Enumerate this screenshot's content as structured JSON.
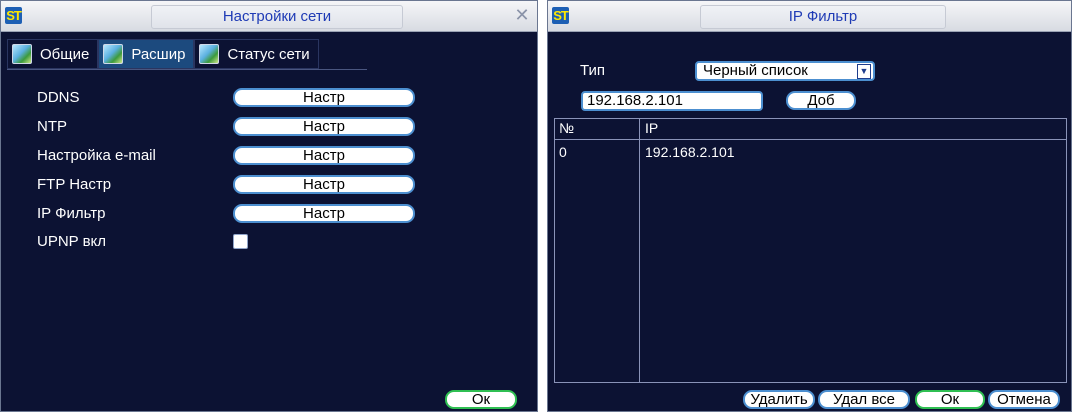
{
  "left_window": {
    "logo": "ST",
    "title": "Настройки сети",
    "tabs": [
      {
        "label": "Общие"
      },
      {
        "label": "Расшир"
      },
      {
        "label": "Статус сети"
      }
    ],
    "rows": [
      {
        "label": "DDNS",
        "button": "Настр"
      },
      {
        "label": "NTP",
        "button": "Настр"
      },
      {
        "label": "Настройка e-mail",
        "button": "Настр"
      },
      {
        "label": "FTP Настр",
        "button": "Настр"
      },
      {
        "label": "IP Фильтр",
        "button": "Настр"
      }
    ],
    "upnp": {
      "label": "UPNP вкл",
      "checked": false
    },
    "ok_label": "Ок"
  },
  "right_window": {
    "logo": "ST",
    "title": "IP Фильтр",
    "type_label": "Тип",
    "type_value": "Черный список",
    "ip_value": "192.168.2.101",
    "add_label": "Доб",
    "table": {
      "headers": [
        "№",
        "IP"
      ],
      "rows": [
        [
          "0",
          "192.168.2.101"
        ]
      ]
    },
    "buttons": {
      "delete": "Удалить",
      "delete_all": "Удал все",
      "ok": "Ок",
      "cancel": "Отмена"
    }
  },
  "colors": {
    "background": "#0c1233",
    "title_text": "#1f3bb5",
    "button_border": "#4c8fd0",
    "ok_border": "#2fbf52",
    "tab_active": "#1c4a7e"
  }
}
